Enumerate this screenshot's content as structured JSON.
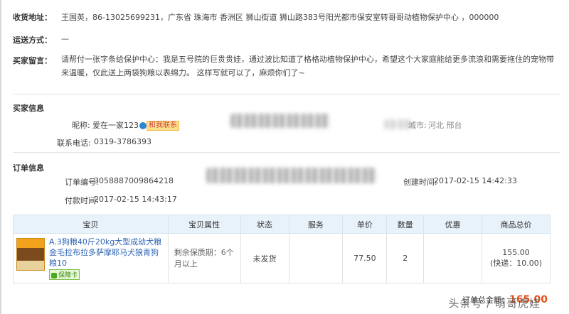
{
  "buyer": {
    "address_label": "收货地址：",
    "address_value": "王国英，86-13025699231，广东省 珠海市 香洲区 狮山街道 狮山路383号阳光都市保安室转哥哥动植物保护中心 ，000000",
    "shipping_label": "运送方式：",
    "shipping_value": "—",
    "message_label": "买家留言：",
    "message_value": "请帮付一张字条给保护中心：我是五号院的巨贵贵娃，通过波比知道了格格动植物保护中心，希望这个大家庭能给更多流浪和需要拖住的宠物带来温暖，仅此送上两袋狗粮以表绵力。 这样写就可以了，麻烦你们了~"
  },
  "buyer_info": {
    "section_title": "买家信息",
    "nickname_label": "昵称:",
    "nickname_value": "爱在一家123",
    "contact_button": "和我联系",
    "phone_label": "联系电话:",
    "phone_value": "0319-3786393",
    "city_label": "城市:",
    "city_value": "河北 邢台"
  },
  "order_info": {
    "section_title": "订单信息",
    "order_no_label": "订单编号:",
    "order_no_value": "3058887009864218",
    "created_label": "创建时间:",
    "created_value": "2017-02-15 14:42:33",
    "paid_label": "付款时间:",
    "paid_value": "2017-02-15 14:43:17"
  },
  "table": {
    "headers": [
      "宝贝",
      "宝贝属性",
      "状态",
      "服务",
      "单价",
      "数量",
      "优惠",
      "商品总价"
    ],
    "row": {
      "product_title": "A.3狗粮40斤20kg大型成幼犬粮金毛拉布拉多萨摩耶马犬狼青狗粮10",
      "protect_badge": "保障卡",
      "attribute": "剩余保质期：6个月以上",
      "status": "未发货",
      "service": "",
      "unit_price": "77.50",
      "quantity": "2",
      "discount": "",
      "total": "155.00",
      "shipping": "(快递：10.00)"
    }
  },
  "footer": {
    "total_label": "订单总金额：",
    "total_amount": "165.00",
    "watermark": "头条号 / 萌哥虎娃"
  },
  "colors": {
    "accent_orange": "#e4511c",
    "header_blue": "#e8f2fb",
    "link_blue": "#2f66b5"
  }
}
